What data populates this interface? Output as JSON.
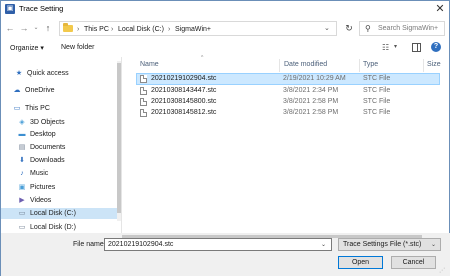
{
  "window": {
    "title": "Trace Setting",
    "close": "✕"
  },
  "address": {
    "crumbs": [
      "This PC",
      "Local Disk (C:)",
      "SigmaWin+"
    ],
    "separator": "›",
    "search_placeholder": "Search SigmaWin+"
  },
  "toolbar": {
    "organize": "Organize ▾",
    "new_folder": "New folder",
    "help": "?"
  },
  "nav": {
    "items": [
      {
        "label": "Quick access",
        "icon": "star-icon",
        "glyph": "★",
        "color": "#2f6fbf"
      },
      {
        "label": "OneDrive",
        "icon": "cloud-icon",
        "glyph": "☁",
        "color": "#2f6fbf"
      },
      {
        "label": "This PC",
        "icon": "computer-icon",
        "glyph": "▭",
        "color": "#2f6fbf"
      },
      {
        "label": "3D Objects",
        "icon": "cube-icon",
        "glyph": "◈",
        "color": "#4a9fd8"
      },
      {
        "label": "Desktop",
        "icon": "desktop-icon",
        "glyph": "▬",
        "color": "#3d8fd1"
      },
      {
        "label": "Documents",
        "icon": "documents-icon",
        "glyph": "▤",
        "color": "#6d7c8f"
      },
      {
        "label": "Downloads",
        "icon": "download-icon",
        "glyph": "⬇",
        "color": "#2f6fbf"
      },
      {
        "label": "Music",
        "icon": "music-icon",
        "glyph": "♪",
        "color": "#2f6fbf"
      },
      {
        "label": "Pictures",
        "icon": "pictures-icon",
        "glyph": "▣",
        "color": "#4a9fd8"
      },
      {
        "label": "Videos",
        "icon": "videos-icon",
        "glyph": "▶",
        "color": "#6d5fb0"
      },
      {
        "label": "Local Disk (C:)",
        "icon": "drive-icon",
        "glyph": "▭",
        "color": "#6d7c8f"
      },
      {
        "label": "Local Disk (D:)",
        "icon": "drive-icon",
        "glyph": "▭",
        "color": "#6d7c8f"
      }
    ]
  },
  "columns": {
    "name": "Name",
    "date": "Date modified",
    "type": "Type",
    "size": "Size"
  },
  "files": [
    {
      "name": "20210219102904.stc",
      "date": "2/19/2021 10:29 AM",
      "type": "STC File",
      "selected": true
    },
    {
      "name": "20210308143447.stc",
      "date": "3/8/2021 2:34 PM",
      "type": "STC File",
      "selected": false
    },
    {
      "name": "20210308145800.stc",
      "date": "3/8/2021 2:58 PM",
      "type": "STC File",
      "selected": false
    },
    {
      "name": "20210308145812.stc",
      "date": "3/8/2021 2:58 PM",
      "type": "STC File",
      "selected": false
    }
  ],
  "footer": {
    "file_name_label": "File name:",
    "file_name_value": "20210219102904.stc",
    "file_type": "Trace Settings File (*.stc)",
    "open": "Open",
    "cancel": "Cancel"
  }
}
